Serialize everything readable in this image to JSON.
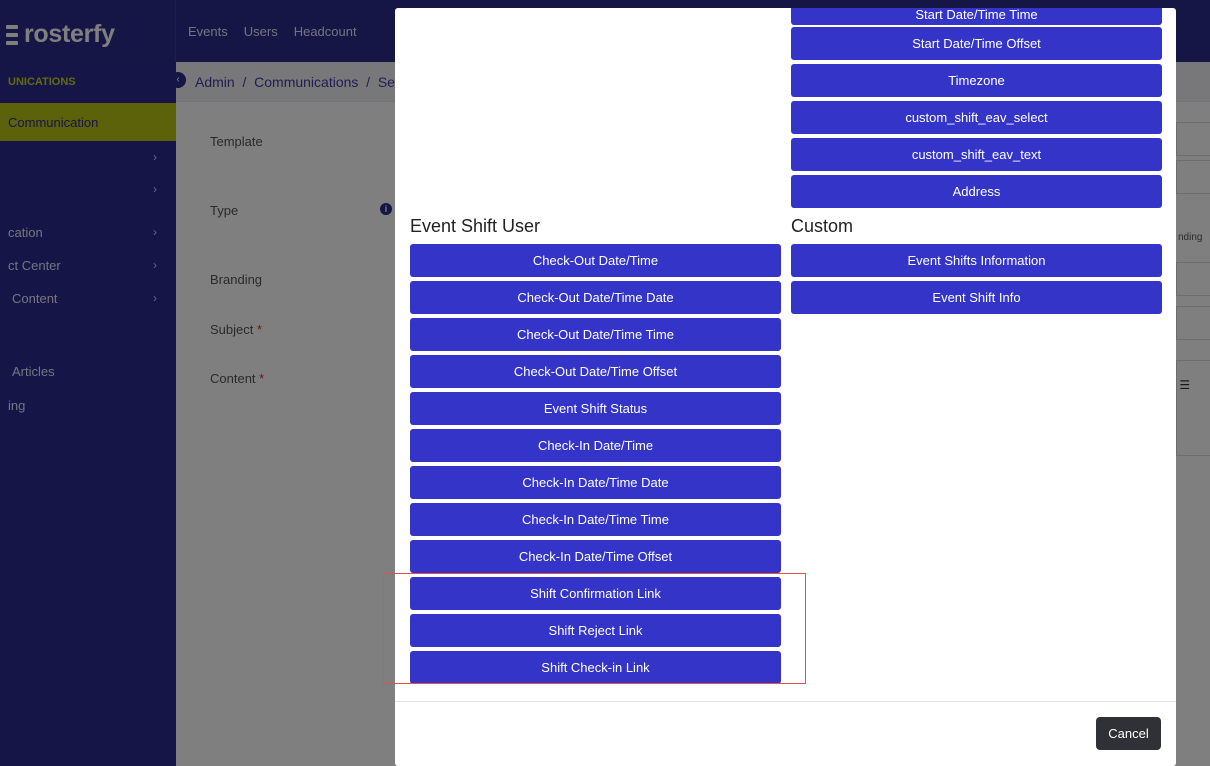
{
  "brand": {
    "logo_text": "rosterfy",
    "accent": "#2a2a8c",
    "highlight": "#b9c515",
    "button_color": "#3434c8"
  },
  "topnav": [
    "Events",
    "Users",
    "Headcount"
  ],
  "sidebar": {
    "title": "UNICATIONS",
    "active": "Communication",
    "items": [
      "cation",
      "ct Center",
      "Content",
      "Articles",
      "ing"
    ]
  },
  "breadcrumb": "Admin  /  Communications  /  Se",
  "form": {
    "template": "Template",
    "type": "Type",
    "branding": "Branding",
    "subject": "Subject",
    "content": "Content",
    "required_mark": "*",
    "peek_pending": "nding"
  },
  "modal": {
    "top_column": [
      "Start Date/Time Time",
      "Start Date/Time Offset",
      "Timezone",
      "custom_shift_eav_select",
      "custom_shift_eav_text",
      "Address"
    ],
    "event_shift_user": {
      "title": "Event Shift User",
      "buttons": [
        "Check-Out Date/Time",
        "Check-Out Date/Time Date",
        "Check-Out Date/Time Time",
        "Check-Out Date/Time Offset",
        "Event Shift Status",
        "Check-In Date/Time",
        "Check-In Date/Time Date",
        "Check-In Date/Time Time",
        "Check-In Date/Time Offset",
        "Shift Confirmation Link",
        "Shift Reject Link",
        "Shift Check-in Link"
      ]
    },
    "custom": {
      "title": "Custom",
      "buttons": [
        "Event Shifts Information",
        "Event Shift Info"
      ]
    },
    "cancel_label": "Cancel"
  }
}
